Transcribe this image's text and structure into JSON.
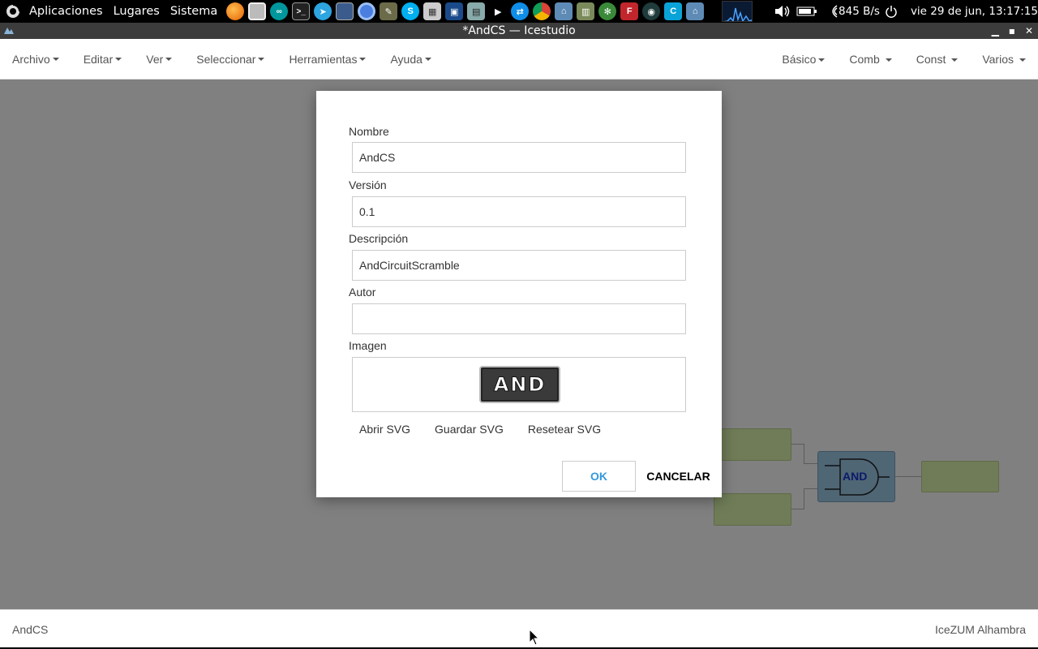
{
  "system_panel": {
    "menus": [
      "Aplicaciones",
      "Lugares",
      "Sistema"
    ],
    "launchers": [
      "firefox-icon",
      "files-icon",
      "arduino-icon",
      "terminal-icon",
      "telegram-icon",
      "monitor-icon",
      "chromium-icon",
      "gimp-icon",
      "skype-icon",
      "calculator-icon",
      "virtualbox-icon",
      "spreadsheet-icon",
      "media-play-icon",
      "teamviewer-icon",
      "chrome-icon",
      "icestudio-icon",
      "kicad-icon",
      "settings-icon",
      "freecad-icon",
      "inkscape-icon",
      "c-app-icon",
      "icestudio-alt-icon"
    ],
    "net_speed": "845 B/s",
    "clock": "vie 29 de jun, 13:17:15"
  },
  "window": {
    "title": "*AndCS — Icestudio"
  },
  "menubar": {
    "left": [
      "Archivo",
      "Editar",
      "Ver",
      "Seleccionar",
      "Herramientas",
      "Ayuda"
    ],
    "right": [
      "Básico",
      "Comb",
      "Const",
      "Varios"
    ]
  },
  "canvas": {
    "gate_label": "AND"
  },
  "dialog": {
    "name_label": "Nombre",
    "name_value": "AndCS",
    "version_label": "Versión",
    "version_value": "0.1",
    "description_label": "Descripción",
    "description_value": "AndCircuitScramble",
    "author_label": "Autor",
    "author_value": "",
    "image_label": "Imagen",
    "image_chip_text": "AND",
    "open_svg": "Abrir SVG",
    "save_svg": "Guardar SVG",
    "reset_svg": "Resetear SVG",
    "ok": "OK",
    "cancel": "CANCELAR"
  },
  "statusbar": {
    "project": "AndCS",
    "board": "IceZUM Alhambra"
  },
  "colors": {
    "accent": "#3498db",
    "block_fill": "#6f7c57",
    "gate_fill": "#4f6675"
  }
}
